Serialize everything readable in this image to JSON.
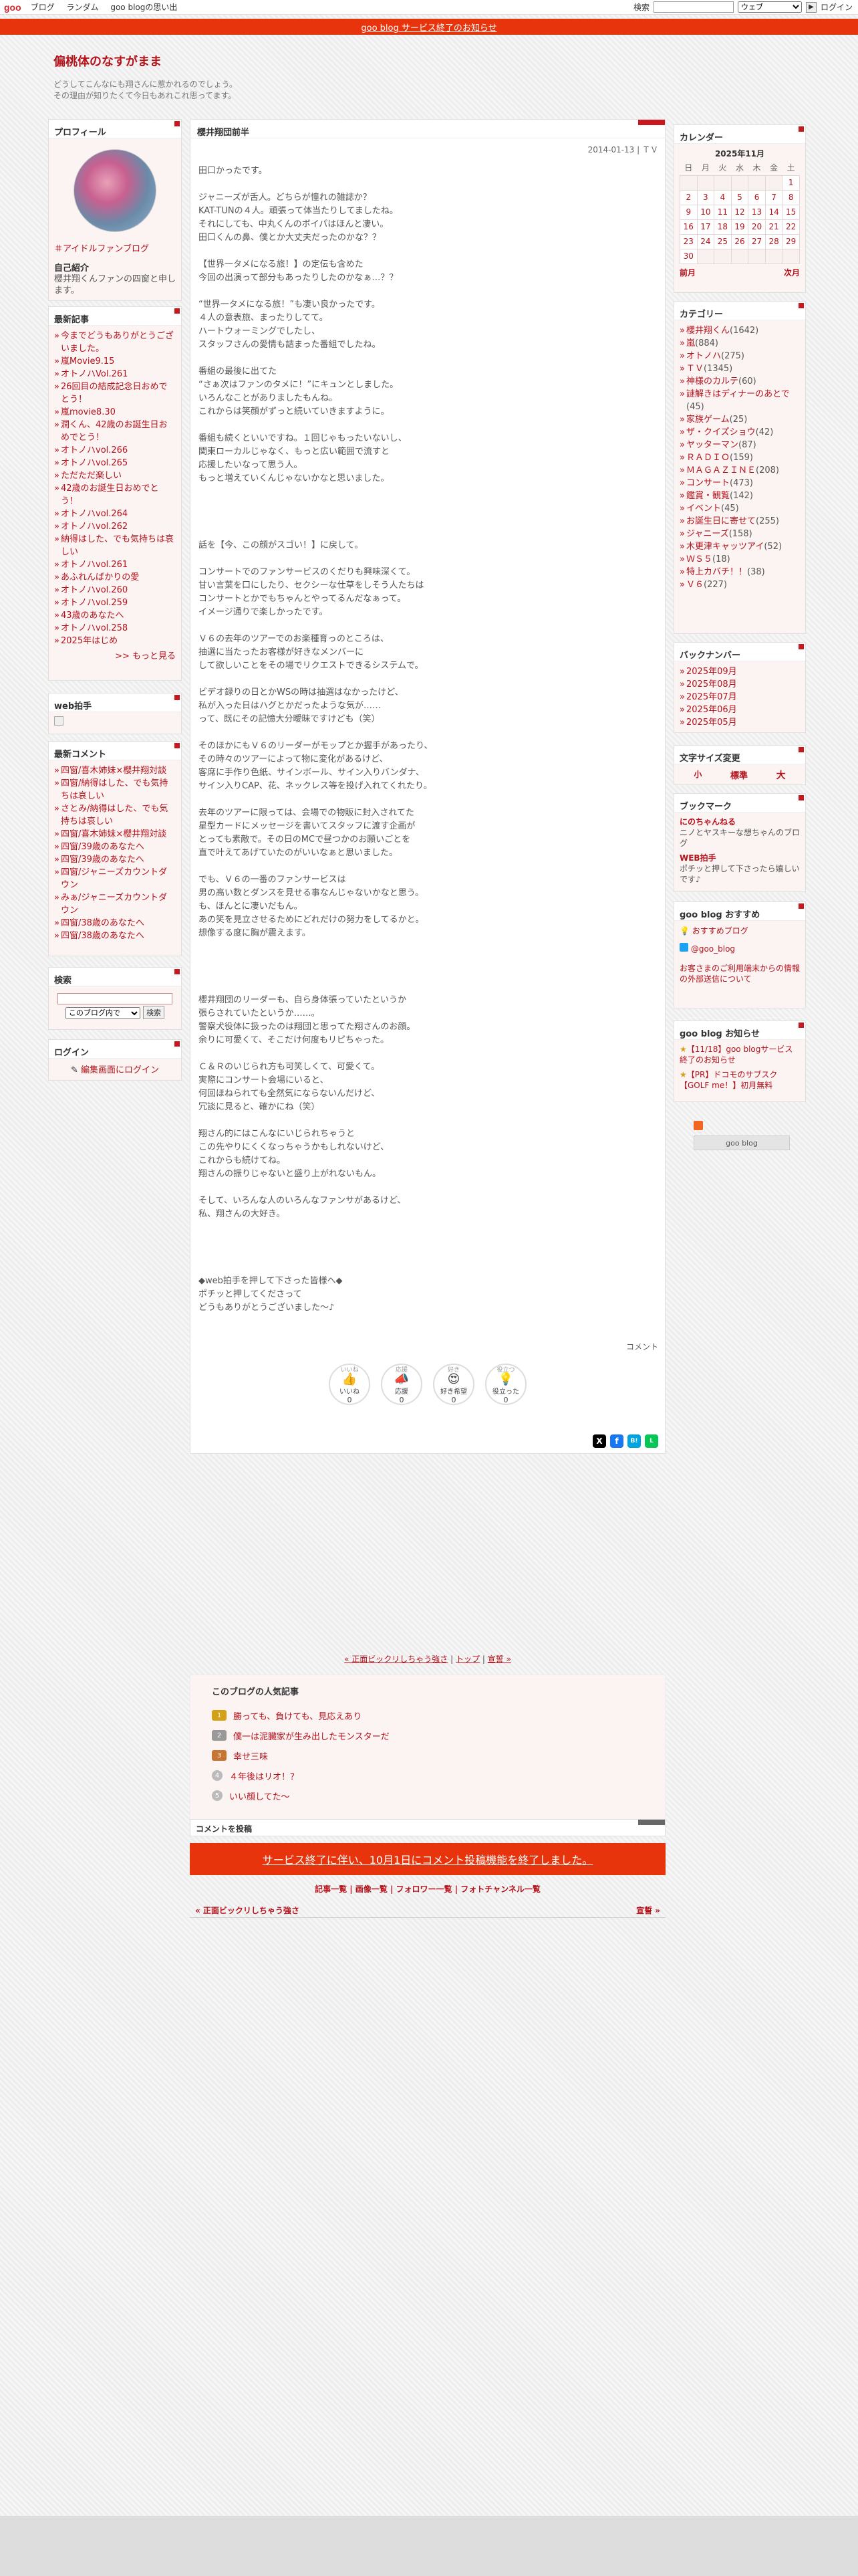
{
  "topbar": {
    "logo": "goo",
    "nav": [
      "ブログ",
      "ランダム",
      "goo blogの思い出"
    ],
    "search_label": "検索",
    "search_scope": "ウェブ",
    "login": "ログイン"
  },
  "notice": {
    "text": "goo blog サービス終了のお知らせ"
  },
  "blog": {
    "title": "偏桃体のなすがまま",
    "desc_line1": "どうしてこんなにも翔さんに惹かれるのでしょう。",
    "desc_line2": "その理由が知りたくて今日もあれこれ思ってます。"
  },
  "profile": {
    "heading": "プロフィール",
    "category": "＃アイドルファンブログ",
    "intro_label": "自己紹介",
    "intro_text": "櫻井翔くんファンの四窗と申します。"
  },
  "recent": {
    "heading": "最新記事",
    "items": [
      "今までどうもありがとうございました。",
      "嵐Movie9.15",
      "オトノハVol.261",
      "26回目の結成記念日おめでとう！",
      "嵐movie8.30",
      "潤くん、42歳のお誕生日おめでとう！",
      "オトノハvol.266",
      "オトノハvol.265",
      "ただただ楽しい",
      "42歳のお誕生日おめでとう！",
      "オトノハvol.264",
      "オトノハvol.262",
      "納得はした、でも気持ちは哀しい",
      "オトノハvol.261",
      "あふれんばかりの愛",
      "オトノハvol.260",
      "オトノハvol.259",
      "43歳のあなたへ",
      "オトノハvol.258",
      "2025年はじめ"
    ],
    "more": ">> もっと見る"
  },
  "webclap": {
    "heading": "web拍手"
  },
  "comments": {
    "heading": "最新コメント",
    "items": [
      "四窗/喜木姉妹×櫻井翔対談",
      "四窗/納得はした、でも気持ちは哀しい",
      "さとみ/納得はした、でも気持ちは哀しい",
      "四窗/喜木姉妹×櫻井翔対談",
      "四窗/39歳のあなたへ",
      "四窗/39歳のあなたへ",
      "四窗/ジャニーズカウントダウン",
      "みぁ/ジャニーズカウントダウン",
      "四窗/38歳のあなたへ",
      "四窗/38歳のあなたへ"
    ]
  },
  "search": {
    "heading": "検索",
    "scope": "このブログ内で",
    "button": "検索"
  },
  "login": {
    "heading": "ログイン",
    "link": "編集画面にログイン"
  },
  "entry": {
    "title": "櫻井翔団前半",
    "meta": "2014-01-13 | ＴＶ",
    "body": "田口かったです。\n\nジャニーズが舌人。どちらが憧れの雑誌か？\nKAT-TUNの４人。頑張って体当たりしてましたね。\nそれにしても、中丸くんのボイパはほんと凄い。\n田口くんの鼻、僕とか大丈夫だったのかな？？\n\n【世界一タメになる旅！】の定伝も含めた\n今回の出演って部分もあったりしたのかなぁ…？？\n\n“世界一タメになる旅！”も凄い良かったです。\n４人の意表旅、まったりしてて。\nハートウォーミングでしたし、\nスタッフさんの愛情も詰まった番組でしたね。\n\n番組の最後に出てた\n“さぁ次はファンのタメに！”にキュンとしました。\nいろんなことがありましたもんね。\nこれからは笑顔がずっと続いていきますように。\n\n番組も続くといいですね。１回じゃもったいないし、\n関東ローカルじゃなく、もっと広い範囲で流すと\n応援したいなって思う人。\nもっと増えていくんじゃないかなと思いました。\n\n\n\n\n話を【今、この顔がスゴい！】に戻して。\n\nコンサートでのファンサービスのくだりも興味深くて。\n甘い言葉を口にしたり、セクシーな仕草をしそう人たちは\nコンサートとかでもちゃんとやってるんだなぁって。\nイメージ通りで楽しかったです。\n\nＶ６の去年のツアーでのお楽種育っのところは、\n抽選に当たったお客様が好きなメンバーに\nして欲しいことをその場でリクエストできるシステムで。\n\nビデオ録りの日とかWSの時は抽選はなかったけど、\n私が入った日はハグとかだったような気が……\nって、既にその記憶大分曖昧ですけども（笑）\n\nそのほかにもＶ６のリーダーがモップとか握手があったり、\nその時々のツアーによって物に変化があるけど、\n客席に手作り色紙、サインボール、サイン入りバンダナ、\nサイン入りCAP、花、ネックレス等を投げ入れてくれたり。\n\n去年のツアーに限っては、会場での物販に封入されてた\n星型カードにメッセージを書いてスタッフに渡す企画が\nとっても素敵で。その日のMCで昼つかのお願いごとを\n直で叶えてあげていたのがいいなぁと思いました。\n\nでも、Ｖ６の一番のファンサービスは\n男の高い数とダンスを見せる事なんじゃないかなと思う。\nも、ほんとに凄いだもん。\nあの笑を見立させるためにどれだけの努力をしてるかと。\n想像する度に胸が震えます。\n\n\n\n\n櫻井翔団のリーダーも、自ら身体張っていたというか\n張らされていたというか……。\n警察犬役体に扱ったのは翔団と思ってた翔さんのお顔。\n余りに可愛くて、そこだけ何度もリピちゃった。\n\nＣ＆Ｒのいじられ方も可笑しくて、可愛くて。\n実際にコンサート会場にいると、\n何回ほねられても全然気にならないんだけど、\n冗談に見ると、確かにね（笑）\n\n翔さん的にはこんなにいじられちゃうと\nこの先やりにくくなっちゃうかもしれないけど、\nこれからも続けてね。\n翔さんの振りじゃないと盛り上がれないもん。\n\nそして、いろんな人のいろんなファンサがあるけど、\n私、翔さんの大好き。\n\n\n\n\n◆web拍手を押して下さった皆様へ◆\nポチッと押してくださって\nどうもありがとうございました〜♪",
    "comment_label": "コメント",
    "reactions": [
      {
        "top": "いいね",
        "label": "いいね",
        "count": "0"
      },
      {
        "top": "応援",
        "label": "応援",
        "count": "0"
      },
      {
        "top": "好き",
        "label": "好き希望",
        "count": "0"
      },
      {
        "top": "役立つ",
        "label": "役立った",
        "count": "0"
      }
    ]
  },
  "pager": {
    "prev": "« 正面ビックリしちゃう強さ",
    "top": "トップ",
    "next": "宣誓 »"
  },
  "popular": {
    "heading": "このブログの人気記事",
    "items": [
      "勝っても、負けても、見応えあり",
      "僕一は泥臓家が生み出したモンスターだ",
      "幸せ三味",
      "４年後はリオ！？",
      "いい顔してた〜"
    ]
  },
  "comment_post": {
    "heading": "コメントを投稿"
  },
  "service_end": {
    "text": "サービス終了に伴い、10月1日にコメント投稿機能を終了しました。"
  },
  "footer": {
    "links": "記事一覧 | 画像一覧 | フォロワー一覧 | フォトチャンネル一覧",
    "prev": "« 正面ビックリしちゃう強さ",
    "next": "宣誓 »"
  },
  "calendar": {
    "heading": "カレンダー",
    "month": "2025年11月",
    "weekdays": [
      "日",
      "月",
      "火",
      "水",
      "木",
      "金",
      "土"
    ],
    "weeks": [
      [
        "",
        "",
        "",
        "",
        "",
        "",
        "1"
      ],
      [
        "2",
        "3",
        "4",
        "5",
        "6",
        "7",
        "8"
      ],
      [
        "9",
        "10",
        "11",
        "12",
        "13",
        "14",
        "15"
      ],
      [
        "16",
        "17",
        "18",
        "19",
        "20",
        "21",
        "22"
      ],
      [
        "23",
        "24",
        "25",
        "26",
        "27",
        "28",
        "29"
      ],
      [
        "30",
        "",
        "",
        "",
        "",
        "",
        ""
      ]
    ],
    "prev": "前月",
    "next": "次月"
  },
  "categories": {
    "heading": "カテゴリー",
    "items": [
      {
        "name": "櫻井翔くん",
        "count": "(1642)"
      },
      {
        "name": "嵐",
        "count": "(884)"
      },
      {
        "name": "オトノハ",
        "count": "(275)"
      },
      {
        "name": "ＴＶ",
        "count": "(1345)"
      },
      {
        "name": "神様のカルテ",
        "count": "(60)"
      },
      {
        "name": "謎解きはディナーのあとで",
        "count": "(45)"
      },
      {
        "name": "家族ゲーム",
        "count": "(25)"
      },
      {
        "name": "ザ・クイズショウ",
        "count": "(42)"
      },
      {
        "name": "ヤッターマン",
        "count": "(87)"
      },
      {
        "name": "ＲＡＤＩＯ",
        "count": "(159)"
      },
      {
        "name": "ＭＡＧＡＺＩＮＥ",
        "count": "(208)"
      },
      {
        "name": "コンサート",
        "count": "(473)"
      },
      {
        "name": "鑑賞・観覧",
        "count": "(142)"
      },
      {
        "name": "イベント",
        "count": "(45)"
      },
      {
        "name": "お誕生日に寄せて",
        "count": "(255)"
      },
      {
        "name": "ジャニーズ",
        "count": "(158)"
      },
      {
        "name": "木更津キャッツアイ",
        "count": "(52)"
      },
      {
        "name": "ＷＳ５",
        "count": "(18)"
      },
      {
        "name": "特上カバチ！！",
        "count": "(38)"
      },
      {
        "name": "Ｖ６",
        "count": "(227)"
      }
    ]
  },
  "backnumber": {
    "heading": "バックナンバー",
    "items": [
      "2025年09月",
      "2025年08月",
      "2025年07月",
      "2025年06月",
      "2025年05月"
    ]
  },
  "fontsize": {
    "heading": "文字サイズ変更",
    "small": "小",
    "medium": "標準",
    "large": "大"
  },
  "bookmark": {
    "heading": "ブックマーク",
    "items": [
      {
        "name": "にのちゃんねる",
        "desc": "ニノとヤスキーな想ちゃんのブログ"
      },
      {
        "name": "WEB拍手",
        "desc": "ポチッと押して下さったら嬉しいです♪"
      }
    ]
  },
  "recommend": {
    "heading": "goo blog おすすめ",
    "item1": "おすすめブログ",
    "item2": "@goo_blog",
    "notice": "お客さまのご利用端末からの情報の外部送信について"
  },
  "gooinfo": {
    "heading": "goo blog お知らせ",
    "items": [
      "【11/18】goo blogサービス終了のお知らせ",
      "【PR】ドコモのサブスク【GOLF me！】初月無料"
    ],
    "badge": "goo blog"
  },
  "colors": {
    "accent": "#b5121b",
    "notice": "#e8340c"
  }
}
